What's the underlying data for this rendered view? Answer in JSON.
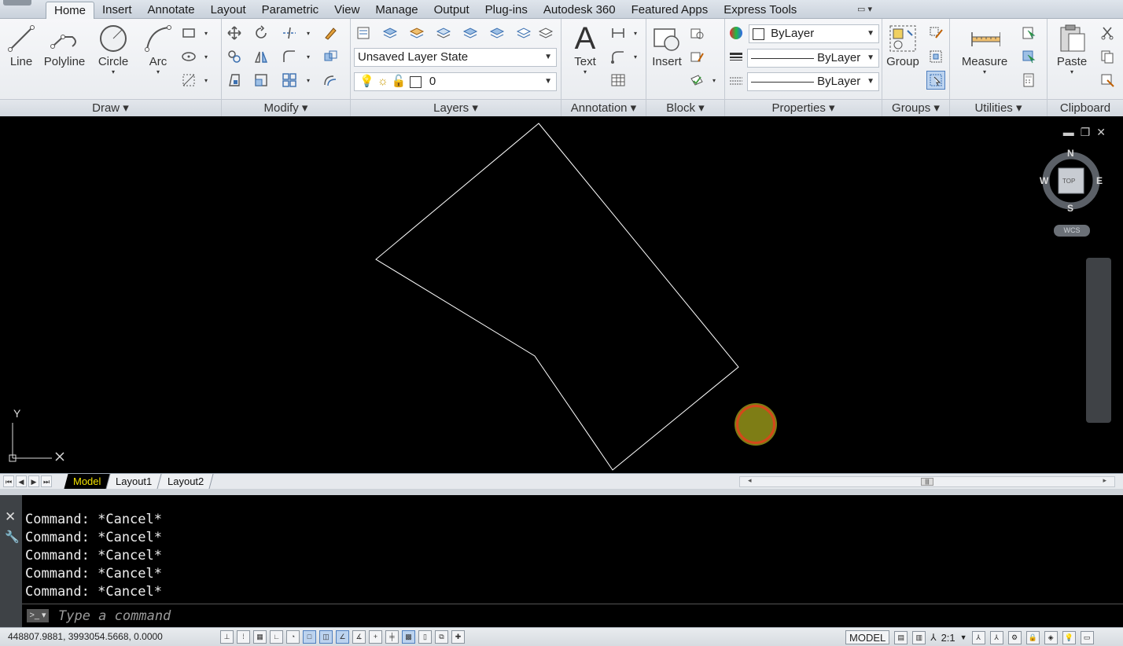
{
  "tabs": [
    {
      "label": "Home",
      "active": true
    },
    {
      "label": "Insert"
    },
    {
      "label": "Annotate"
    },
    {
      "label": "Layout"
    },
    {
      "label": "Parametric"
    },
    {
      "label": "View"
    },
    {
      "label": "Manage"
    },
    {
      "label": "Output"
    },
    {
      "label": "Plug-ins"
    },
    {
      "label": "Autodesk 360"
    },
    {
      "label": "Featured Apps"
    },
    {
      "label": "Express Tools"
    }
  ],
  "ribbon": {
    "draw": {
      "title": "Draw ▾",
      "line": "Line",
      "polyline": "Polyline",
      "circle": "Circle",
      "arc": "Arc"
    },
    "modify": {
      "title": "Modify ▾"
    },
    "layers": {
      "title": "Layers ▾",
      "layer_state": "Unsaved Layer State",
      "current_layer": "0"
    },
    "annotation": {
      "title": "Annotation ▾",
      "text": "Text"
    },
    "block": {
      "title": "Block ▾",
      "insert": "Insert"
    },
    "properties": {
      "title": "Properties ▾",
      "color": "ByLayer",
      "lineweight": "ByLayer",
      "linetype": "ByLayer"
    },
    "groups": {
      "title": "Groups ▾",
      "group": "Group"
    },
    "utilities": {
      "title": "Utilities ▾",
      "measure": "Measure"
    },
    "clipboard": {
      "title": "Clipboard",
      "paste": "Paste"
    }
  },
  "viewcube": {
    "n": "N",
    "s": "S",
    "e": "E",
    "w": "W",
    "face": "TOP",
    "wcs": "WCS"
  },
  "ucs": {
    "y": "Y"
  },
  "layout_tabs": [
    "Model",
    "Layout1",
    "Layout2"
  ],
  "command": {
    "history": [
      "Command: *Cancel*",
      "Command: *Cancel*",
      "Command: *Cancel*",
      "Command: *Cancel*",
      "Command: *Cancel*"
    ],
    "placeholder": "Type a command"
  },
  "status": {
    "coords": "448807.9881, 3993054.5668, 0.0000",
    "space": "MODEL",
    "annotation_scale": "2:1"
  },
  "colors": {
    "accent": "#f4e400",
    "cursor_fill": "#7e7d15",
    "cursor_ring": "#d4481b"
  }
}
